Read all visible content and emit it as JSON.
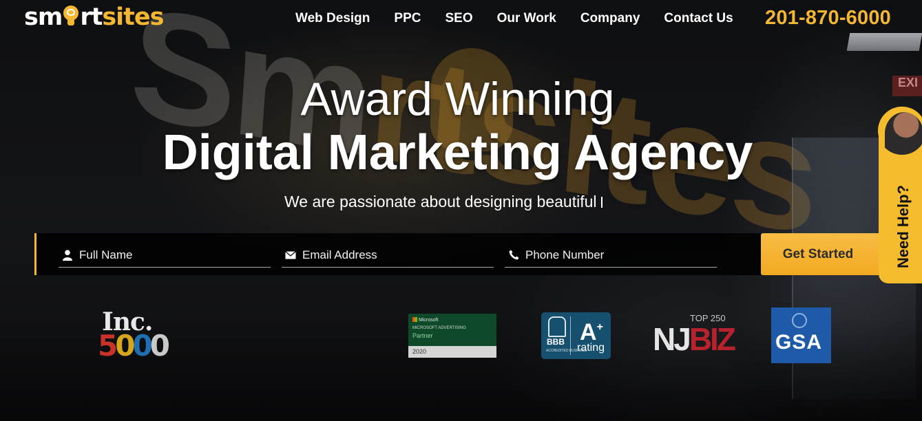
{
  "brand": {
    "logo_text_left": "sm",
    "logo_text_mid": "rt",
    "logo_text_right": "sites",
    "accent_color": "#f5b731"
  },
  "background": {
    "wall_sign_left": "Sm",
    "wall_sign_right": "rtsites",
    "exit_sign": "EXI"
  },
  "nav": {
    "items": [
      {
        "label": "Web Design"
      },
      {
        "label": "PPC"
      },
      {
        "label": "SEO"
      },
      {
        "label": "Our Work"
      },
      {
        "label": "Company"
      },
      {
        "label": "Contact Us"
      }
    ],
    "phone": "201-870-6000"
  },
  "hero": {
    "headline_line1": "Award Winning",
    "headline_line2": "Digital Marketing Agency",
    "tagline": "We are passionate about designing beautiful"
  },
  "form": {
    "name_placeholder": "Full Name",
    "email_placeholder": "Email Address",
    "phone_placeholder": "Phone Number",
    "submit_label": "Get Started"
  },
  "help": {
    "label": "Need Help?"
  },
  "awards": {
    "inc": {
      "line1": "Inc.",
      "digit_5": "5",
      "digit_0a": "0",
      "digit_0b": "0",
      "digit_0c": "0"
    },
    "microsoft": {
      "brand": "Microsoft",
      "program": "MICROSOFT ADVERTISING",
      "tier": "Partner",
      "year": "2020"
    },
    "bbb": {
      "mark": "BBB",
      "accredited": "ACCREDITED BUSINESS",
      "grade": "A",
      "grade_plus": "+",
      "rating": "rating"
    },
    "njbiz": {
      "top": "TOP 250",
      "nj": "NJ",
      "biz": "BIZ"
    },
    "gsa": {
      "text": "GSA"
    }
  }
}
